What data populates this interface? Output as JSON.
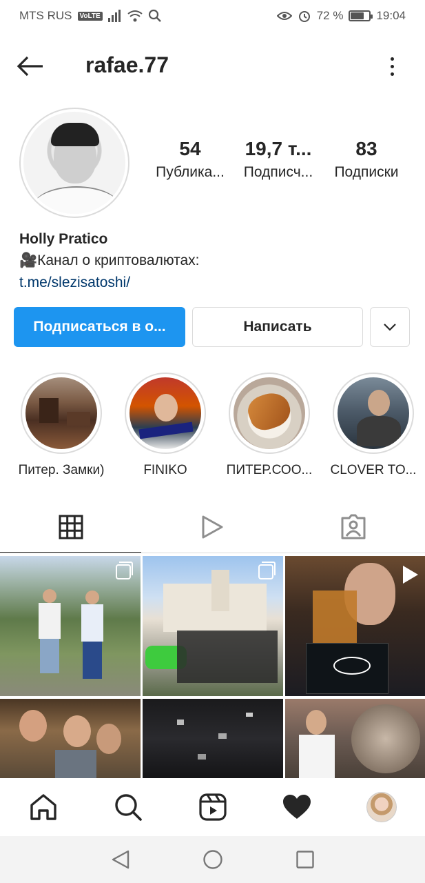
{
  "status_bar": {
    "carrier": "MTS RUS",
    "volte": "VoLTE",
    "battery_percent": "72 %",
    "battery_level": 0.72,
    "time": "19:04",
    "icons": [
      "signal-icon",
      "wifi-icon",
      "search-icon",
      "eye-icon",
      "alarm-icon",
      "battery-icon"
    ]
  },
  "header": {
    "username": "rafae.77"
  },
  "profile": {
    "stats": [
      {
        "value": "54",
        "label": "Публика..."
      },
      {
        "value": "19,7 т...",
        "label": "Подписч..."
      },
      {
        "value": "83",
        "label": "Подписки"
      }
    ],
    "name": "Holly Pratico",
    "bio": "🎥Канал о криптовалютах:",
    "link": "t.me/slezisatoshi/"
  },
  "actions": {
    "follow_label": "Подписаться в о...",
    "message_label": "Написать"
  },
  "highlights": [
    {
      "label": "Питер. Замки)"
    },
    {
      "label": "FINIKO"
    },
    {
      "label": "ПИТЕР.СОО..."
    },
    {
      "label": "CLOVER TO..."
    }
  ],
  "tabs": [
    {
      "name": "grid",
      "icon": "grid-icon",
      "active": true
    },
    {
      "name": "reels",
      "icon": "reels-play-icon",
      "active": false
    },
    {
      "name": "tagged",
      "icon": "tagged-person-icon",
      "active": false
    }
  ],
  "bottom_nav": [
    "home-icon",
    "search-icon",
    "reels-icon",
    "heart-icon",
    "profile-avatar"
  ],
  "colors": {
    "primary_button": "#1d95f0",
    "link": "#00376b",
    "text": "#262626",
    "border": "#dbdbdb"
  }
}
